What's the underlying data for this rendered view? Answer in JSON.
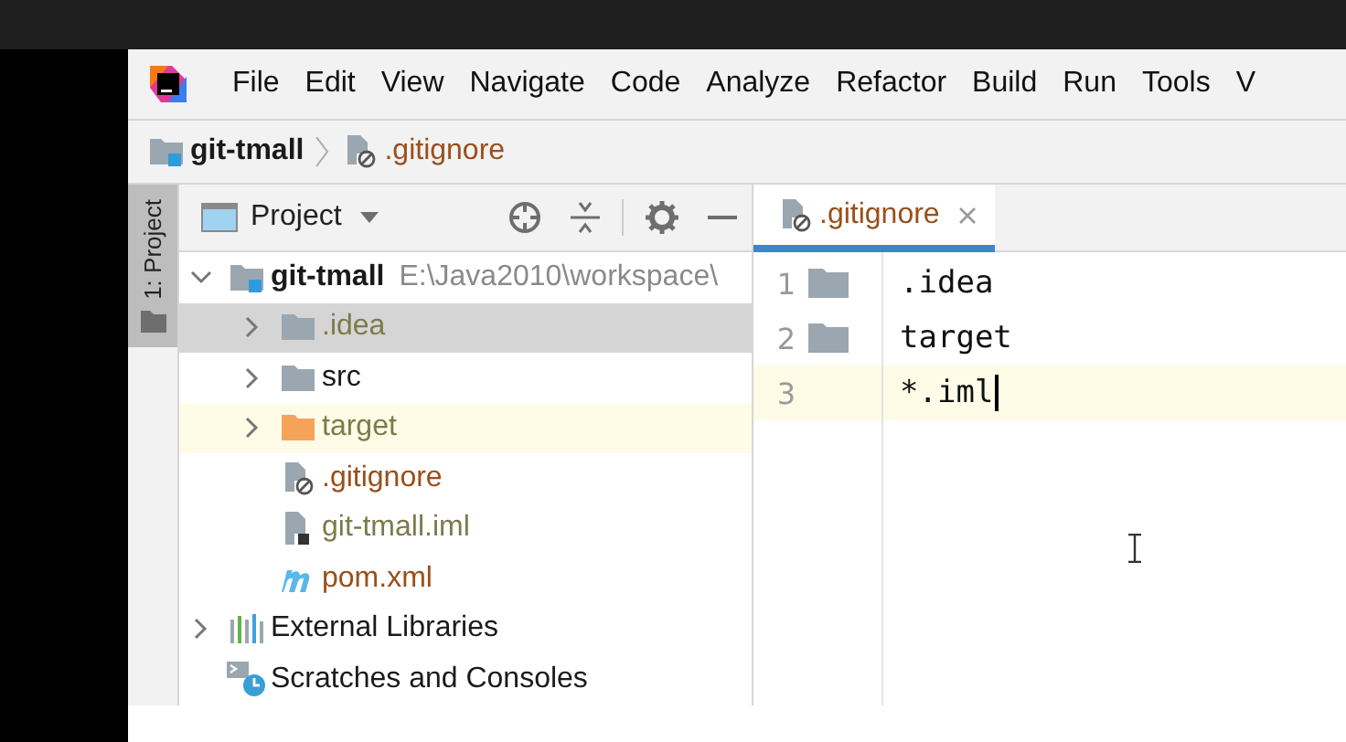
{
  "menu": [
    "File",
    "Edit",
    "View",
    "Navigate",
    "Code",
    "Analyze",
    "Refactor",
    "Build",
    "Run",
    "Tools",
    "V"
  ],
  "breadcrumb": [
    {
      "label": "git-tmall",
      "kind": "module",
      "color": "#1a1a1a"
    },
    {
      "label": ".gitignore",
      "kind": "ignore-file",
      "color": "#9a4f1c"
    }
  ],
  "tool_strip": [
    {
      "label": "1: Project",
      "selected": true
    }
  ],
  "project_panel": {
    "title": "Project"
  },
  "tree": [
    {
      "label": "git-tmall",
      "kind": "module",
      "path": "E:\\Java2010\\workspace\\",
      "expanded": true,
      "selected": false,
      "highlighted": false,
      "color": "#1a1a1a",
      "children": [
        {
          "label": ".idea",
          "kind": "folder",
          "expanded": false,
          "selected": true,
          "highlighted": false,
          "color": "#7b7b4c"
        },
        {
          "label": "src",
          "kind": "folder",
          "expanded": false,
          "selected": false,
          "highlighted": false,
          "color": "#1a1a1a"
        },
        {
          "label": "target",
          "kind": "excluded-folder",
          "expanded": false,
          "selected": false,
          "highlighted": true,
          "color": "#7b7b4c"
        },
        {
          "label": ".gitignore",
          "kind": "ignore-file",
          "selected": false,
          "highlighted": false,
          "color": "#9a4f1c"
        },
        {
          "label": "git-tmall.iml",
          "kind": "iml-file",
          "selected": false,
          "highlighted": false,
          "color": "#7b7b4c"
        },
        {
          "label": "pom.xml",
          "kind": "maven-file",
          "selected": false,
          "highlighted": false,
          "color": "#9a4f1c"
        }
      ]
    },
    {
      "label": "External Libraries",
      "kind": "libraries",
      "expanded": false,
      "selected": false,
      "highlighted": false,
      "color": "#1a1a1a"
    },
    {
      "label": "Scratches and Consoles",
      "kind": "scratches",
      "selected": false,
      "highlighted": false,
      "color": "#1a1a1a"
    }
  ],
  "editor": {
    "tabs": [
      {
        "label": ".gitignore",
        "kind": "ignore-file",
        "selected": true,
        "color": "#9a4f1c"
      }
    ],
    "lines": [
      {
        "number": "1",
        "text": ".idea",
        "kind": "folder",
        "current": false,
        "caret": false
      },
      {
        "number": "2",
        "text": "target",
        "kind": "folder",
        "current": false,
        "caret": false
      },
      {
        "number": "3",
        "text": "*.iml",
        "kind": "plain",
        "current": true,
        "caret": true
      }
    ]
  }
}
